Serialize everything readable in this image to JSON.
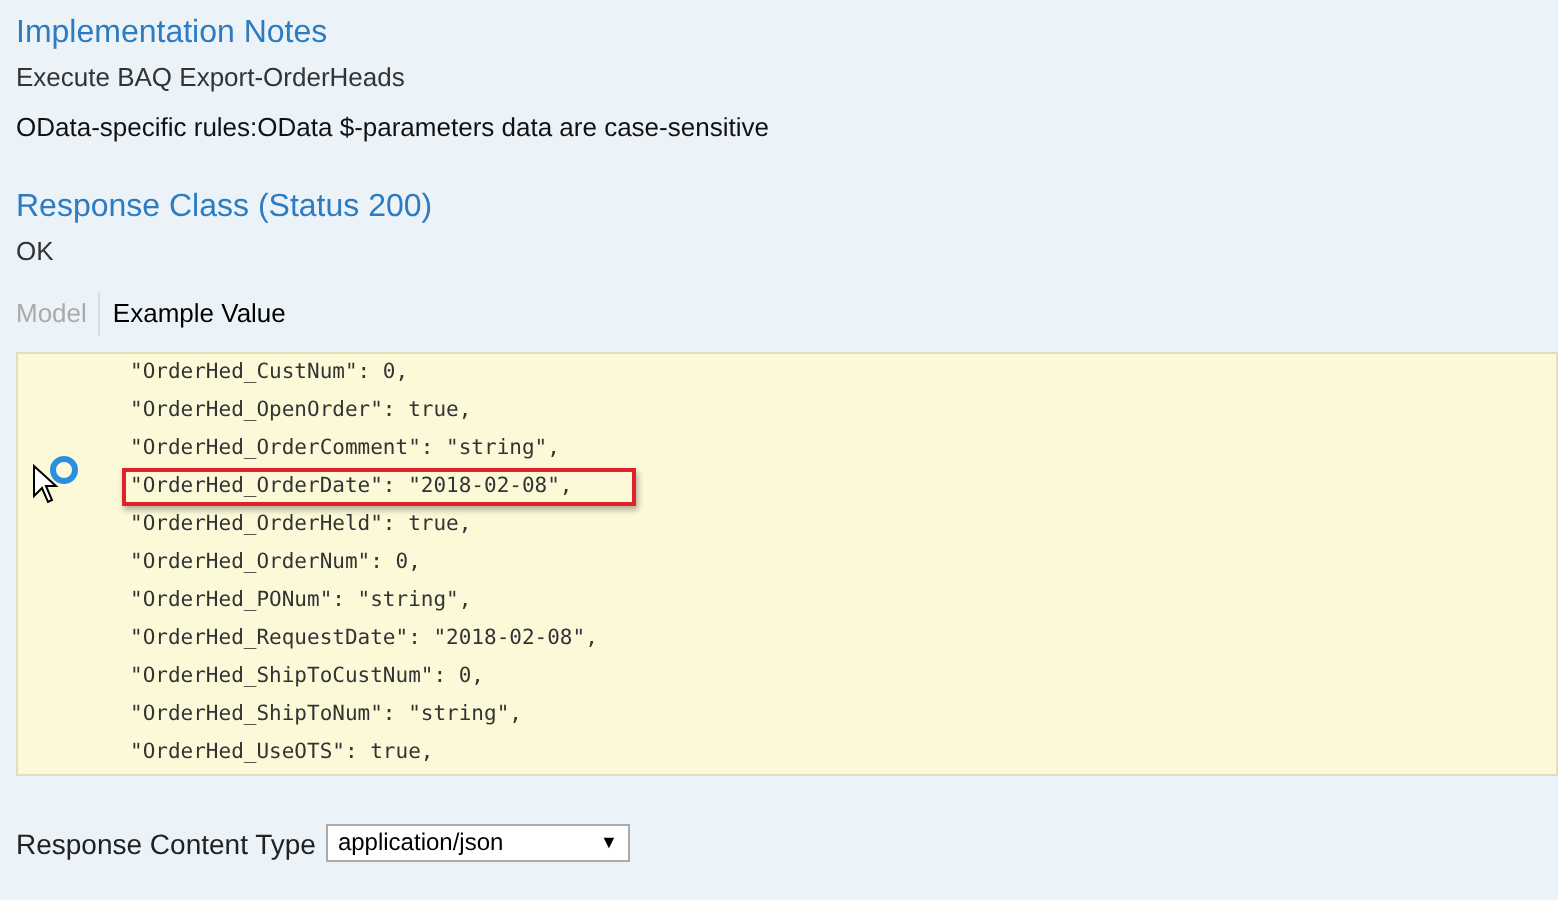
{
  "implementation_notes": {
    "title": "Implementation Notes",
    "summary": "Execute BAQ Export-OrderHeads",
    "rules": "OData-specific rules:OData $-parameters data are case-sensitive"
  },
  "response_class": {
    "title": "Response Class (Status 200)",
    "status_text": "OK"
  },
  "tabs": [
    {
      "label": "Model",
      "selected": false
    },
    {
      "label": "Example Value",
      "selected": true
    }
  ],
  "example_lines": [
    {
      "text": "\"OrderHed_CustNum\": 0,",
      "highlighted": false
    },
    {
      "text": "\"OrderHed_OpenOrder\": true,",
      "highlighted": false
    },
    {
      "text": "\"OrderHed_OrderComment\": \"string\",",
      "highlighted": false
    },
    {
      "text": "\"OrderHed_OrderDate\": \"2018-02-08\",",
      "highlighted": true
    },
    {
      "text": "\"OrderHed_OrderHeld\": true,",
      "highlighted": false
    },
    {
      "text": "\"OrderHed_OrderNum\": 0,",
      "highlighted": false
    },
    {
      "text": "\"OrderHed_PONum\": \"string\",",
      "highlighted": false
    },
    {
      "text": "\"OrderHed_RequestDate\": \"2018-02-08\",",
      "highlighted": false
    },
    {
      "text": "\"OrderHed_ShipToCustNum\": 0,",
      "highlighted": false
    },
    {
      "text": "\"OrderHed_ShipToNum\": \"string\",",
      "highlighted": false
    },
    {
      "text": "\"OrderHed_UseOTS\": true,",
      "highlighted": false
    }
  ],
  "content_type": {
    "label": "Response Content Type",
    "value": "application/json",
    "arrow": "▼"
  }
}
